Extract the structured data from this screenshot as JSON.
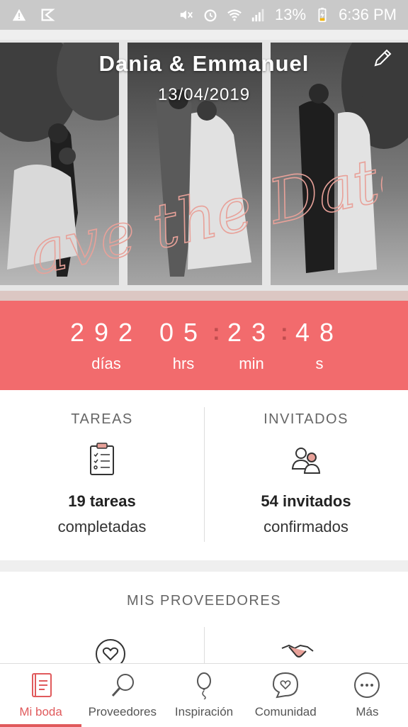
{
  "status_bar": {
    "battery": "13%",
    "time": "6:36 PM"
  },
  "hero": {
    "couple_name": "Dania & Emmanuel",
    "wedding_date": "13/04/2019",
    "overlay_script": "Save the Date"
  },
  "countdown": {
    "days": "292",
    "days_label": "días",
    "hours": "05",
    "hours_label": "hrs",
    "minutes": "23",
    "minutes_label": "min",
    "seconds": "48",
    "seconds_label": "s"
  },
  "tasks": {
    "title": "TAREAS",
    "count": "19 tareas",
    "sub": "completadas"
  },
  "guests": {
    "title": "INVITADOS",
    "count": "54 invitados",
    "sub": "confirmados"
  },
  "providers": {
    "title": "MIS PROVEEDORES"
  },
  "nav": {
    "items": [
      {
        "label": "Mi boda"
      },
      {
        "label": "Proveedores"
      },
      {
        "label": "Inspiración"
      },
      {
        "label": "Comunidad"
      },
      {
        "label": "Más"
      }
    ]
  },
  "colors": {
    "accent": "#f26b6d",
    "accent_dark": "#e05a5c",
    "script": "#e8a199"
  }
}
